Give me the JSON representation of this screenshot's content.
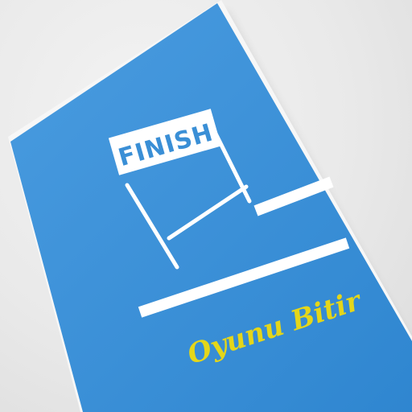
{
  "photo": {
    "background_color": "#e9e9e9",
    "card_color": "#3a8fd6",
    "line_color": "#ffffff",
    "title_color": "#e4d61a",
    "finish_sign_text": "FINISH",
    "caption": "Oyunu Bitir"
  }
}
